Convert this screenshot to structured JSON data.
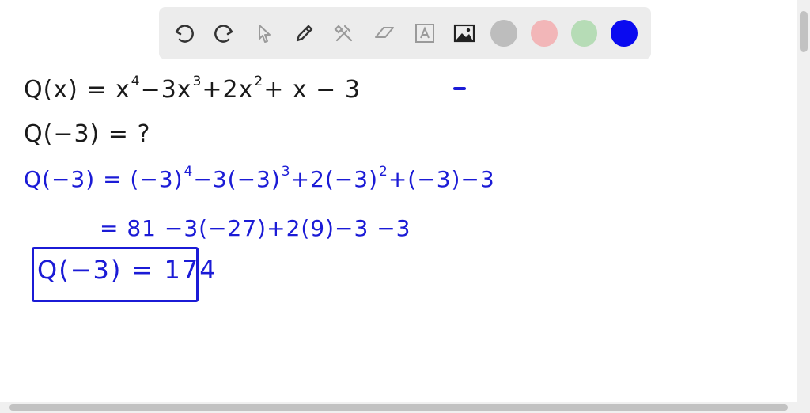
{
  "toolbar": {
    "tools": [
      "undo-icon",
      "redo-icon",
      "pointer-icon",
      "pencil-icon",
      "tools-icon",
      "eraser-icon",
      "text-icon",
      "image-icon"
    ],
    "colors": [
      "#bdbdbd",
      "#f2b6b8",
      "#b6dcb6",
      "#0a0af0"
    ]
  },
  "lines": {
    "line1": "Q(x) = x",
    "line1_sup1": "4",
    "line1_b": "−3x",
    "line1_sup2": "3",
    "line1_c": "+2x",
    "line1_sup3": "2",
    "line1_d": "+ x − 3",
    "line2": "Q(−3) = ?",
    "line3_a": "Q(−3) = (−3)",
    "line3_sup1": "4",
    "line3_b": "−3(−3)",
    "line3_sup2": "3",
    "line3_c": "+2(−3)",
    "line3_sup3": "2",
    "line3_d": "+(−3)−3",
    "line4": "= 81 −3(−27)+2(9)−3 −3",
    "answer": "Q(−3) = 174"
  }
}
